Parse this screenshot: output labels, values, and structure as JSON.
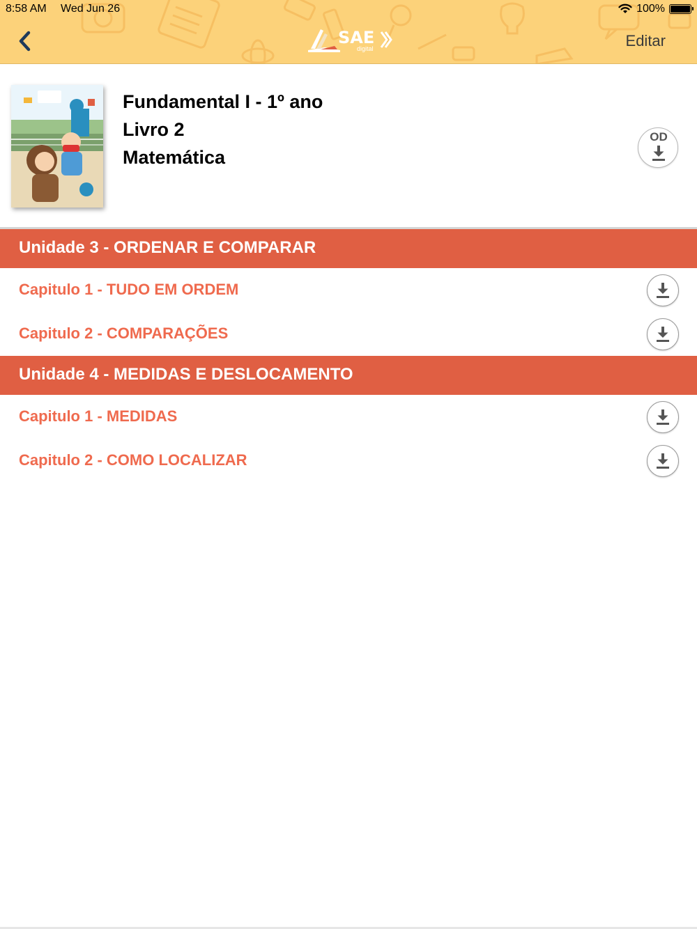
{
  "status_bar": {
    "time": "8:58 AM",
    "date": "Wed Jun 26",
    "battery": "100%",
    "wifi_icon": "wifi-icon",
    "battery_icon": "battery-icon"
  },
  "header": {
    "back_icon": "chevron-left-icon",
    "logo_text": "SAE",
    "logo_sub": "digital",
    "edit_label": "Editar",
    "background_color": "#fcd27a"
  },
  "book": {
    "line1": "Fundamental I - 1º ano",
    "line2": "Livro 2",
    "line3": "Matemática",
    "od_label": "OD",
    "od_icon": "download-icon"
  },
  "units": [
    {
      "title": "Unidade 3 - ORDENAR E COMPARAR",
      "chapters": [
        {
          "title": "Capitulo 1 - TUDO EM ORDEM",
          "icon": "download-icon"
        },
        {
          "title": "Capitulo 2 - COMPARAÇÕES",
          "icon": "download-icon"
        }
      ]
    },
    {
      "title": "Unidade 4 - MEDIDAS E DESLOCAMENTO",
      "chapters": [
        {
          "title": "Capitulo 1 - MEDIDAS",
          "icon": "download-icon"
        },
        {
          "title": "Capitulo 2 - COMO LOCALIZAR",
          "icon": "download-icon"
        }
      ]
    }
  ],
  "colors": {
    "unit_header": "#e05f43",
    "chapter_text": "#ef6a4e",
    "header_bg": "#fcd27a"
  }
}
